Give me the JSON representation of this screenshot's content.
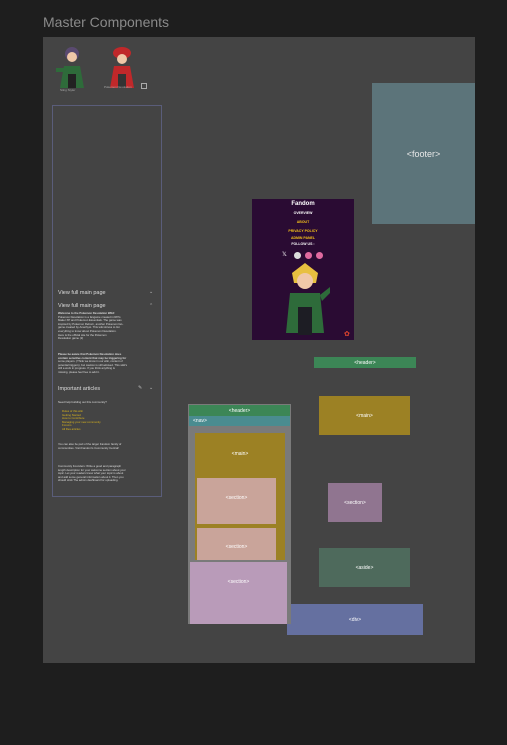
{
  "page_title": "Master Components",
  "thumbnails": [
    {
      "caption": "Sting Styler"
    },
    {
      "caption": "Pokemon Desolation"
    }
  ],
  "sidebar": {
    "view_full_main_page_1": "View full main page",
    "view_full_main_page_2": "View full main page",
    "intro_line1": "Welcome to the Pokemon Desolation Wiki!",
    "intro_line2": "Pokemon Desolation is a fangame created in RPG",
    "intro_line3": "Maker XP and Pokemon Essentials. The game was",
    "intro_line4": "inspired by Pokemon Reborn, another Pokemon fan-",
    "intro_line5": "game created by Amethyst. This wiki strives to list",
    "intro_line6": "everything to know about Pokemon Desolation.",
    "intro_line7": "Here is the official site for the Pokemon",
    "intro_line8": "Desolation game (2)",
    "warn_line1": "Please be aware that Pokemon Desolation does",
    "warn_line2": "contain sensitive content that may be triggering for",
    "warn_line3": "some players. (Think we know in our wiki, content of",
    "warn_line4": "potential triggers), but caution is still advised. This wiki's",
    "warn_line5": "still a work in progress. If you think anything is",
    "warn_line6": "missing, please feel free to add it.",
    "important_articles": "Important articles",
    "help_text": "Need help building out this community?",
    "links": [
      "Rules of this wiki",
      "Getting Started",
      "How to Contribute",
      "Managing your new community",
      "Forums",
      "All files articles"
    ],
    "bottom_line1": "You can also be part of the larger Fandom family of",
    "bottom_line2": "communities. Visit Fandom's Community Central!",
    "cf_line1": "Community Founders: Write a good and paragraph",
    "cf_line2": "length description for your welcome section about your",
    "cf_line3": "topic. Let your readers know what your topic is about",
    "cf_line4": "and add some general information about it. Then you",
    "cf_line5": "should stick The admin dashboard for uploading."
  },
  "boxes": {
    "footer": "<footer>",
    "header": "<header>",
    "main": "<main>",
    "section": "<section>",
    "aside": "<aside>",
    "div": "<div>"
  },
  "layout": {
    "header": "<header>",
    "nav": "<nav>",
    "main": "<main>",
    "section1": "<section>",
    "section2": "<section>",
    "section3": "<section>"
  },
  "fandom_card": {
    "logo": "Fandom",
    "overview": "OVERVIEW",
    "about": "ABOUT",
    "privacy": "PRIVACY POLICY",
    "admin": "ADMIN PANEL",
    "follow": "FOLLOW US :",
    "colors": {
      "accent": "#f5c21a",
      "bg": "#2a0b33"
    }
  }
}
